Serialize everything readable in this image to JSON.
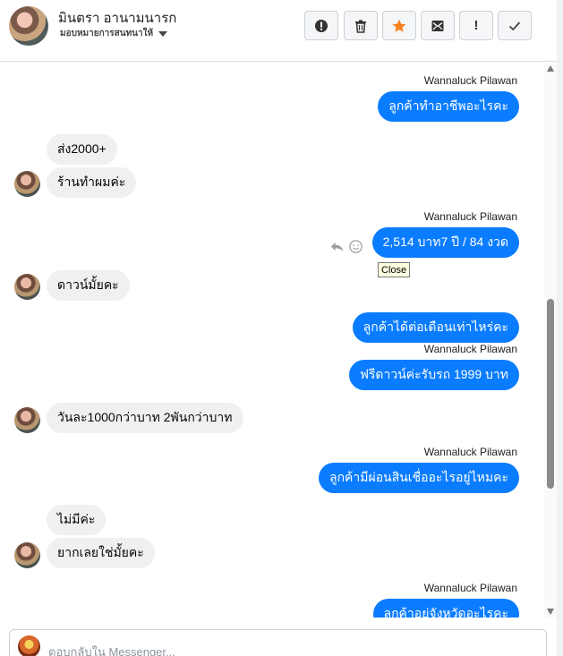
{
  "header": {
    "contact_name": "มินตรา อานามนารก",
    "assign_label": "มอบหมายการสนทนาให้",
    "toolbar": {
      "spam_icon": "alert-circle-icon",
      "delete_icon": "trash-icon",
      "star_icon": "star-icon",
      "archive_icon": "mail-archive-icon",
      "follow_up_label": "!",
      "done_icon": "check-icon"
    }
  },
  "colors": {
    "outgoing_bubble": "#0a7cff",
    "incoming_bubble": "#f0f0f0",
    "star": "#f5841f"
  },
  "messages": {
    "m1_sender": "Wannaluck Pilawan",
    "m1_text": "ลูกค้าทำอาชีพอะไรคะ",
    "m2_text": "ส่ง2000+",
    "m3_text": "ร้านทำผมค่ะ",
    "m4_sender": "Wannaluck Pilawan",
    "m4_text": "2,514 บาท7 ปี / 84 งวด",
    "m5_text": "ดาวน์มั้ยคะ",
    "m6_text": "ลูกค้าได้ต่อเดือนเท่าไหร่คะ",
    "m7_sender": "Wannaluck Pilawan",
    "m7_text": "ฟรีดาวน์ค่ะรับรถ 1999 บาท",
    "m8_text": "วันละ1000กว่าบาท 2พันกว่าบาท",
    "m9_sender": "Wannaluck Pilawan",
    "m9_text": "ลูกค้ามีผ่อนสินเชื่ออะไรอยู่ไหมคะ",
    "m10_text": "ไม่มีค่ะ",
    "m11_text": "ยากเลยใช่มั้ยคะ",
    "m12_sender": "Wannaluck Pilawan",
    "m12_text": "ลูกค้าอยู่จังหวัดอะไรคะ"
  },
  "tooltip_text": "Close",
  "reply": {
    "placeholder": "ตอบกลับใน Messenger..."
  }
}
